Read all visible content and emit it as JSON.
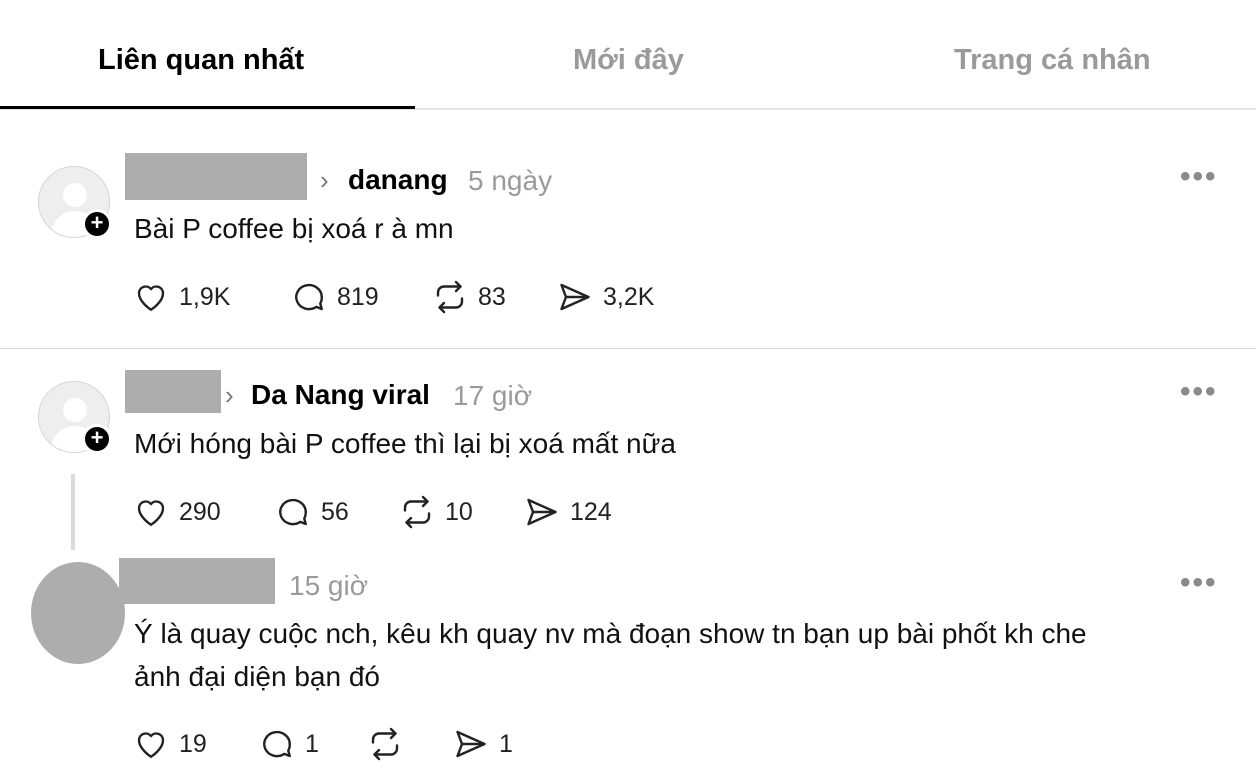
{
  "tabs": [
    {
      "label": "Liên quan nhất"
    },
    {
      "label": "Mới đây"
    },
    {
      "label": "Trang cá nhân"
    }
  ],
  "posts": [
    {
      "community": "danang",
      "time": "5 ngày",
      "text": "Bài P coffee bị xoá r à mn",
      "stats": {
        "likes": "1,9K",
        "comments": "819",
        "reposts": "83",
        "shares": "3,2K"
      }
    },
    {
      "community": "Da Nang viral",
      "time": "17 giờ",
      "text": "Mới hóng bài P coffee thì lại bị xoá mất nữa",
      "stats": {
        "likes": "290",
        "comments": "56",
        "reposts": "10",
        "shares": "124"
      }
    },
    {
      "time": "15 giờ",
      "text_line1": "Ý là quay cuộc nch, kêu kh quay nv mà đoạn show tn bạn up bài phốt kh che",
      "text_line2": "ảnh đại diện bạn đó",
      "stats": {
        "likes": "19",
        "comments": "1",
        "reposts": "",
        "shares": "1"
      }
    }
  ],
  "icons": {
    "more": "more-horizontal-icon",
    "like": "heart-icon",
    "comment": "comment-bubble-icon",
    "repost": "repost-icon",
    "share": "send-icon",
    "follow": "plus-icon"
  },
  "colors": {
    "active_tab": "#000000",
    "inactive_tab": "#9a9a9a",
    "redaction": "#adadad"
  }
}
